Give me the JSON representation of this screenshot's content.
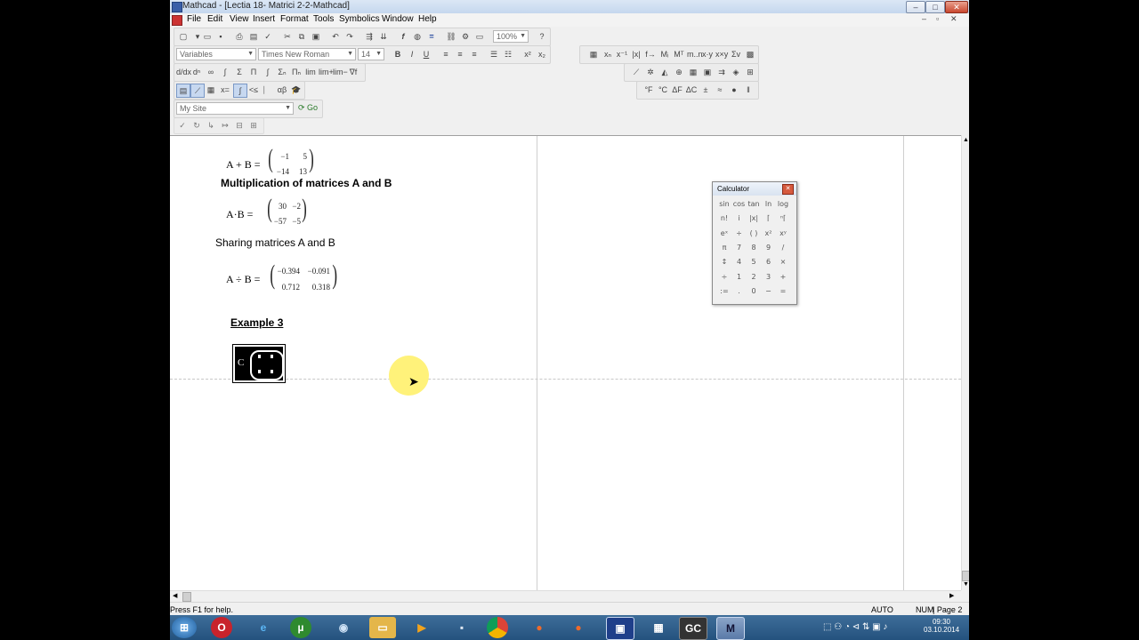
{
  "window": {
    "title": "Mathcad - [Lectia 18- Matrici 2-2-Mathcad]"
  },
  "menu": [
    "File",
    "Edit",
    "View",
    "Insert",
    "Format",
    "Tools",
    "Symbolics",
    "Window",
    "Help"
  ],
  "toolbar": {
    "zoom": "100%",
    "style": "Variables",
    "font": "Times New Roman",
    "font_size": "14",
    "site": "My Site",
    "go": "Go"
  },
  "document": {
    "sum_lhs": "A + B =",
    "sum_matrix": [
      "−1",
      "5",
      "−14",
      "13"
    ],
    "mult_heading": "Multiplication of matrices A and B",
    "mult_lhs": "A·B =",
    "mult_matrix": [
      "30",
      "−2",
      "−57",
      "−5"
    ],
    "share_heading": "Sharing matrices A and B",
    "share_lhs": "A ÷ B =",
    "share_matrix": [
      "−0.394",
      "−0.091",
      "0.712",
      "0.318"
    ],
    "example_heading": "Example 3",
    "placeholder_var": "C"
  },
  "calculator": {
    "title": "Calculator",
    "rows": [
      [
        "sin",
        "cos",
        "tan",
        "ln",
        "log"
      ],
      [
        "n!",
        "i",
        "|x|",
        "⌈",
        "ⁿ⌈"
      ],
      [
        "eˣ",
        "÷",
        "( )",
        "x²",
        "xʸ"
      ],
      [
        "π",
        "7",
        "8",
        "9",
        "/"
      ],
      [
        "↕",
        "4",
        "5",
        "6",
        "×"
      ],
      [
        "÷",
        "1",
        "2",
        "3",
        "+"
      ],
      [
        ":=",
        ".",
        "0",
        "−",
        "="
      ]
    ]
  },
  "status": {
    "help": "Press F1 for help.",
    "auto": "AUTO",
    "num": "NUM",
    "page": "Page 2"
  },
  "clock": {
    "time": "09:30",
    "date": "03.10.2014"
  }
}
